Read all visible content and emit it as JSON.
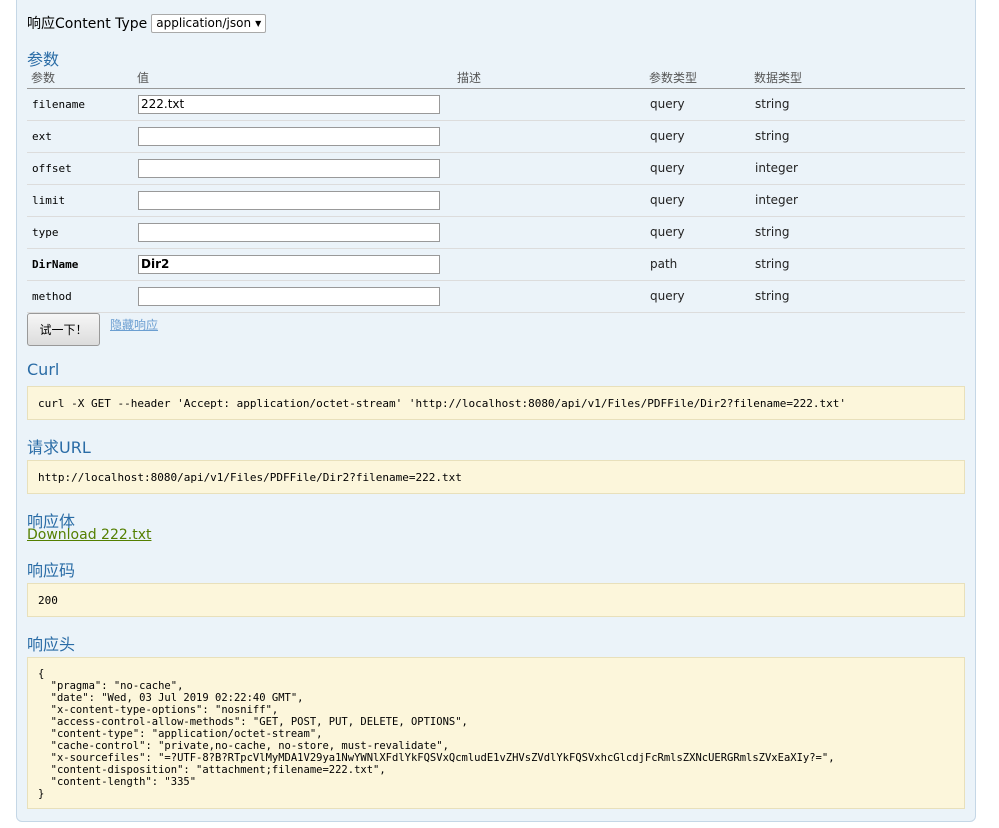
{
  "content_type": {
    "label": "响应Content Type",
    "selected": "application/json"
  },
  "params_section": {
    "title": "参数",
    "columns": [
      "参数",
      "值",
      "描述",
      "参数类型",
      "数据类型"
    ],
    "rows": [
      {
        "name": "filename",
        "value": "222.txt",
        "description": "",
        "param_type": "query",
        "data_type": "string",
        "required": false
      },
      {
        "name": "ext",
        "value": "",
        "description": "",
        "param_type": "query",
        "data_type": "string",
        "required": false
      },
      {
        "name": "offset",
        "value": "",
        "description": "",
        "param_type": "query",
        "data_type": "integer",
        "required": false
      },
      {
        "name": "limit",
        "value": "",
        "description": "",
        "param_type": "query",
        "data_type": "integer",
        "required": false
      },
      {
        "name": "type",
        "value": "",
        "description": "",
        "param_type": "query",
        "data_type": "string",
        "required": false
      },
      {
        "name": "DirName",
        "value": "Dir2",
        "description": "",
        "param_type": "path",
        "data_type": "string",
        "required": true
      },
      {
        "name": "method",
        "value": "",
        "description": "",
        "param_type": "query",
        "data_type": "string",
        "required": false
      }
    ]
  },
  "actions": {
    "try_label": "试一下！",
    "hide_label": "隐藏响应"
  },
  "curl": {
    "title": "Curl",
    "command": "curl -X GET --header 'Accept: application/octet-stream' 'http://localhost:8080/api/v1/Files/PDFFile/Dir2?filename=222.txt'"
  },
  "request_url": {
    "title": "请求URL",
    "url": "http://localhost:8080/api/v1/Files/PDFFile/Dir2?filename=222.txt"
  },
  "response_body": {
    "title": "响应体",
    "download_label": "Download 222.txt"
  },
  "response_code": {
    "title": "响应码",
    "code": "200"
  },
  "response_headers": {
    "title": "响应头",
    "text": "{\n  \"pragma\": \"no-cache\",\n  \"date\": \"Wed, 03 Jul 2019 02:22:40 GMT\",\n  \"x-content-type-options\": \"nosniff\",\n  \"access-control-allow-methods\": \"GET, POST, PUT, DELETE, OPTIONS\",\n  \"content-type\": \"application/octet-stream\",\n  \"cache-control\": \"private,no-cache, no-store, must-revalidate\",\n  \"x-sourcefiles\": \"=?UTF-8?B?RTpcVlMyMDA1V29ya1NwYWNlXFdlYkFQSVxQcmludE1vZHVsZVdlYkFQSVxhcGlcdjFcRmlsZXNcUERGRmlsZVxEaXIy?=\",\n  \"content-disposition\": \"attachment;filename=222.txt\",\n  \"content-length\": \"335\"\n}"
  }
}
